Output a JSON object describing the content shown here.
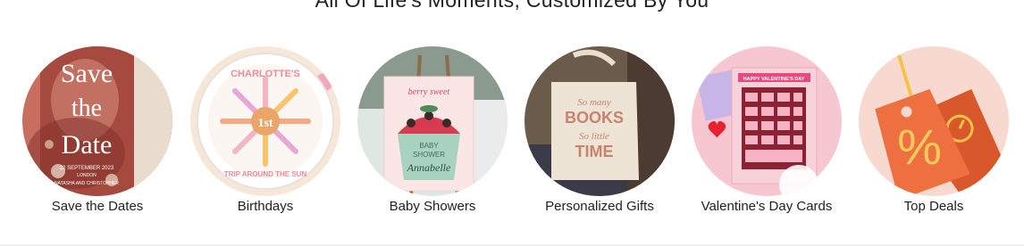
{
  "heading": "All Of Life's Moments, Customized By You",
  "categories": [
    {
      "label": "Save the Dates",
      "card_text": {
        "save": "Save",
        "the": "the",
        "date": "Date",
        "date_line": "22 SEPTEMBER 2023",
        "city": "LONDON",
        "names": "NATASHA AND CHRISTOPHER"
      }
    },
    {
      "label": "Birthdays",
      "card_text": {
        "top": "CHARLOTTE'S",
        "center": "1st",
        "bottom": "TRIP AROUND THE SUN"
      }
    },
    {
      "label": "Baby Showers",
      "card_text": {
        "top": "berry sweet",
        "line1": "BABY",
        "line2": "SHOWER",
        "name": "Annabelle"
      }
    },
    {
      "label": "Personalized Gifts",
      "card_text": {
        "line1": "So many",
        "line2": "BOOKS",
        "line3": "So little",
        "line4": "TIME"
      }
    },
    {
      "label": "Valentine's Day Cards",
      "card_text": {
        "banner": "HAPPY VALENTINE'S DAY"
      }
    },
    {
      "label": "Top Deals",
      "card_text": {
        "symbol": "%"
      }
    }
  ],
  "colors": {
    "save_the_dates_bg": "#b55a50",
    "birthdays_bg": "#f6e7d8",
    "baby_showers_bg": "#dfe7e2",
    "gifts_bg": "#5e5246",
    "valentines_bg": "#f7c7d1",
    "deals_bg": "#f8d9cf",
    "deals_tag": "#ee7040"
  }
}
